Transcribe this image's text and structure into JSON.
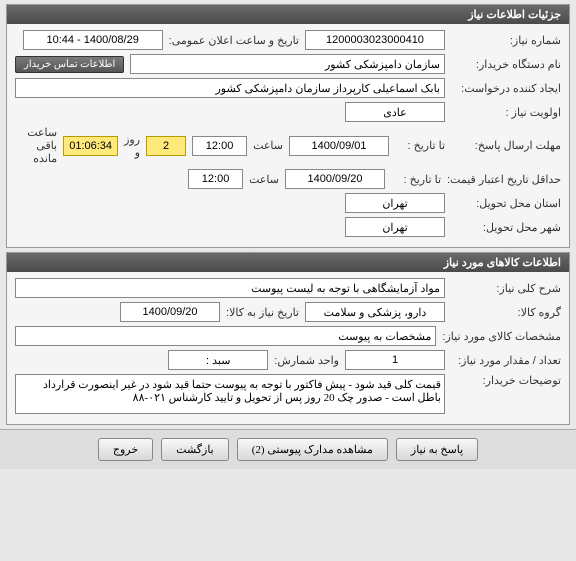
{
  "panel1": {
    "title": "جزئیات اطلاعات نیاز",
    "need_no_label": "شماره نیاز:",
    "need_no": "1200003023000410",
    "announce_label": "تاریخ و ساعت اعلان عمومی:",
    "announce_value": "1400/08/29 - 10:44",
    "buyer_org_label": "نام دستگاه خریدار:",
    "buyer_org": "سازمان دامپزشکی کشور",
    "contact_btn": "اطلاعات تماس خریدار",
    "creator_label": "ایجاد کننده درخواست:",
    "creator": "بابک اسماعیلی کارپرداز سازمان دامپزشکی کشور",
    "priority_label": "اولویت نیاز :",
    "priority": "عادی",
    "deadline_label": "مهلت ارسال پاسخ:",
    "to_date_label": "تا تاریخ :",
    "deadline_date": "1400/09/01",
    "time_label": "ساعت",
    "deadline_time": "12:00",
    "days_remaining": "2",
    "days_and_label": "روز و",
    "time_remaining": "01:06:34",
    "remaining_label": "ساعت باقی مانده",
    "price_valid_label": "حداقل تاریخ اعتبار قیمت:",
    "price_valid_date": "1400/09/20",
    "price_valid_time": "12:00",
    "deliver_state_label": "استان محل تحویل:",
    "deliver_state": "تهران",
    "deliver_city_label": "شهر محل تحویل:",
    "deliver_city": "تهران"
  },
  "panel2": {
    "title": "اطلاعات کالاهای مورد نیاز",
    "desc_label": "شرح کلی نیاز:",
    "desc": "مواد آزمایشگاهی با توجه به لیست پیوست",
    "group_label": "گروه کالا:",
    "group": "دارو، پزشکی و سلامت",
    "need_date_label": "تاریخ نیاز به کالا:",
    "need_date": "1400/09/20",
    "spec_label": "مشخصات کالای مورد نیاز:",
    "spec": "مشخصات به پیوست",
    "qty_label": "تعداد / مقدار مورد نیاز:",
    "qty": "1",
    "unit_label": "واحد شمارش:",
    "unit": "سبد :",
    "buyer_notes_label": "توضیحات خریدار:",
    "buyer_notes": "قیمت کلی قید شود - پیش فاکتور با توجه به پیوست حتما قید شود در غیر اینصورت قرارداد باطل است - صدور چک 20 روز پس از تحویل و تایید کارشناس ۰۲۱-۸۸"
  },
  "buttons": {
    "reply": "پاسخ به نیاز",
    "attachments": "مشاهده مدارک پیوستی (2)",
    "back": "بازگشت",
    "exit": "خروج"
  }
}
